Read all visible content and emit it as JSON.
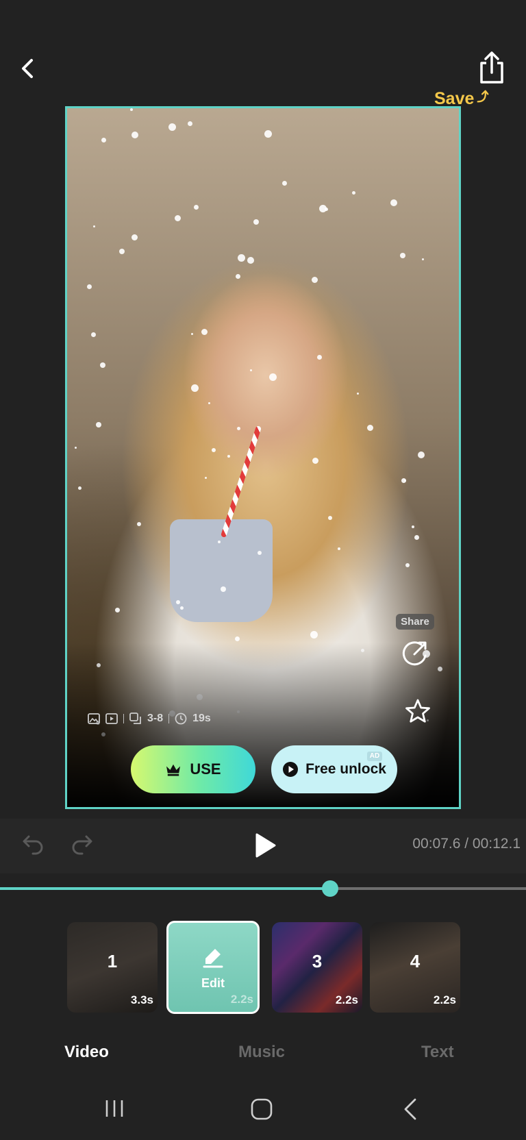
{
  "header": {
    "back_icon": "chevron-left-icon",
    "share_icon": "share-export-icon",
    "save_hint": "Save"
  },
  "preview": {
    "meta": {
      "images_icon": "image-icon",
      "video_icon": "video-icon",
      "clip_range": "3-8",
      "duration": "19s"
    },
    "share_label": "Share",
    "favorite_icon": "star-icon",
    "use_label": "USE",
    "unlock_label": "Free unlock",
    "ad_badge": "AD"
  },
  "playback": {
    "time": "00:07.6 / 00:12.1",
    "progress_fraction": 0.628
  },
  "clips": [
    {
      "number": "1",
      "duration": "3.3s",
      "selected": false
    },
    {
      "number": "",
      "action": "Edit",
      "duration": "2.2s",
      "selected": true
    },
    {
      "number": "3",
      "duration": "2.2s",
      "selected": false
    },
    {
      "number": "4",
      "duration": "2.2s",
      "selected": false
    }
  ],
  "tabs": [
    {
      "label": "Video",
      "active": true
    },
    {
      "label": "Music",
      "active": false
    },
    {
      "label": "Text",
      "active": false
    }
  ],
  "colors": {
    "accent": "#5fd3c6",
    "save_hint": "#f5c84a",
    "background": "#222222"
  }
}
